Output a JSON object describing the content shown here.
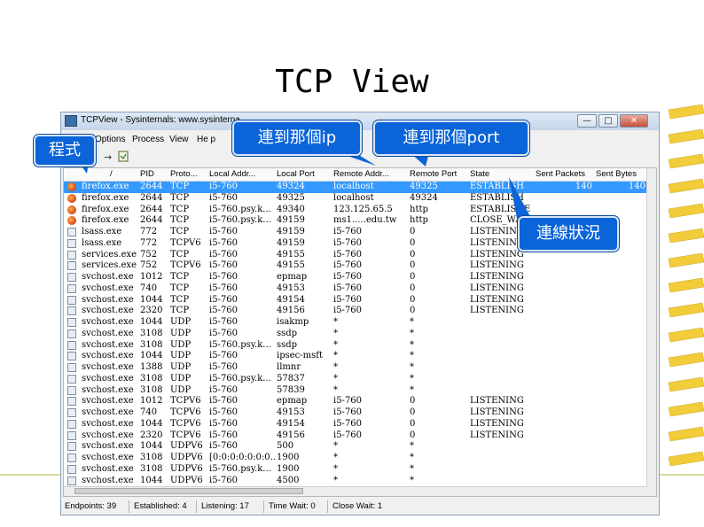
{
  "slide": {
    "title": "TCP View"
  },
  "window": {
    "title": "TCPView - Sysinternals: www.sysinterna",
    "buttons": {
      "minimize": "—",
      "maximize": "□",
      "close": "✕"
    }
  },
  "menu": [
    "Options",
    "Process",
    "View",
    "He p"
  ],
  "toolbar": {
    "refresh_arrow": "→"
  },
  "columns": [
    "",
    "PID",
    "Proto...",
    "Local Addr...",
    "Local Port",
    "Remote Addr...",
    "Remote Port",
    "State",
    "Sent Packets",
    "Sent Bytes"
  ],
  "sort_indicator": "/",
  "rows": [
    {
      "icon": "firefox",
      "process": "firefox.exe",
      "pid": "2644",
      "proto": "TCP",
      "laddr": "i5-760",
      "lport": "49324",
      "raddr": "localhost",
      "rport": "49325",
      "state": "ESTABLISH",
      "packets": "140",
      "bytes": "140",
      "selected": true
    },
    {
      "icon": "firefox",
      "process": "firefox.exe",
      "pid": "2644",
      "proto": "TCP",
      "laddr": "i5-760",
      "lport": "49325",
      "raddr": "localhost",
      "rport": "49324",
      "state": "ESTABLISH",
      "packets": "",
      "bytes": ""
    },
    {
      "icon": "firefox",
      "process": "firefox.exe",
      "pid": "2644",
      "proto": "TCP",
      "laddr": "i5-760.psy.k...",
      "lport": "49340",
      "raddr": "123.125.65.5",
      "rport": "http",
      "state": "ESTABLISHE",
      "packets": "",
      "bytes": ""
    },
    {
      "icon": "firefox",
      "process": "firefox.exe",
      "pid": "2644",
      "proto": "TCP",
      "laddr": "i5-760.psy.k...",
      "lport": "49159",
      "raddr": "ms1.....edu.tw",
      "rport": "http",
      "state": "CLOSE_WA",
      "packets": "",
      "bytes": ""
    },
    {
      "icon": "app",
      "process": "lsass.exe",
      "pid": "772",
      "proto": "TCP",
      "laddr": "i5-760",
      "lport": "49159",
      "raddr": "i5-760",
      "rport": "0",
      "state": "LISTENING",
      "packets": "",
      "bytes": ""
    },
    {
      "icon": "app",
      "process": "lsass.exe",
      "pid": "772",
      "proto": "TCPV6",
      "laddr": "i5-760",
      "lport": "49159",
      "raddr": "i5-760",
      "rport": "0",
      "state": "LISTENING",
      "packets": "",
      "bytes": ""
    },
    {
      "icon": "app",
      "process": "services.exe",
      "pid": "752",
      "proto": "TCP",
      "laddr": "i5-760",
      "lport": "49155",
      "raddr": "i5-760",
      "rport": "0",
      "state": "LISTENING",
      "packets": "",
      "bytes": ""
    },
    {
      "icon": "app",
      "process": "services.exe",
      "pid": "752",
      "proto": "TCPV6",
      "laddr": "i5-760",
      "lport": "49155",
      "raddr": "i5-760",
      "rport": "0",
      "state": "LISTENING",
      "packets": "",
      "bytes": ""
    },
    {
      "icon": "app",
      "process": "svchost.exe",
      "pid": "1012",
      "proto": "TCP",
      "laddr": "i5-760",
      "lport": "epmap",
      "raddr": "i5-760",
      "rport": "0",
      "state": "LISTENING",
      "packets": "",
      "bytes": ""
    },
    {
      "icon": "app",
      "process": "svchost.exe",
      "pid": "740",
      "proto": "TCP",
      "laddr": "i5-760",
      "lport": "49153",
      "raddr": "i5-760",
      "rport": "0",
      "state": "LISTENING",
      "packets": "",
      "bytes": ""
    },
    {
      "icon": "app",
      "process": "svchost.exe",
      "pid": "1044",
      "proto": "TCP",
      "laddr": "i5-760",
      "lport": "49154",
      "raddr": "i5-760",
      "rport": "0",
      "state": "LISTENING",
      "packets": "",
      "bytes": ""
    },
    {
      "icon": "app",
      "process": "svchost.exe",
      "pid": "2320",
      "proto": "TCP",
      "laddr": "i5-760",
      "lport": "49156",
      "raddr": "i5-760",
      "rport": "0",
      "state": "LISTENING",
      "packets": "",
      "bytes": ""
    },
    {
      "icon": "app",
      "process": "svchost.exe",
      "pid": "1044",
      "proto": "UDP",
      "laddr": "i5-760",
      "lport": "isakmp",
      "raddr": "*",
      "rport": "*",
      "state": "",
      "packets": "",
      "bytes": ""
    },
    {
      "icon": "app",
      "process": "svchost.exe",
      "pid": "3108",
      "proto": "UDP",
      "laddr": "i5-760",
      "lport": "ssdp",
      "raddr": "*",
      "rport": "*",
      "state": "",
      "packets": "",
      "bytes": ""
    },
    {
      "icon": "app",
      "process": "svchost.exe",
      "pid": "3108",
      "proto": "UDP",
      "laddr": "i5-760.psy.k...",
      "lport": "ssdp",
      "raddr": "*",
      "rport": "*",
      "state": "",
      "packets": "",
      "bytes": ""
    },
    {
      "icon": "app",
      "process": "svchost.exe",
      "pid": "1044",
      "proto": "UDP",
      "laddr": "i5-760",
      "lport": "ipsec-msft",
      "raddr": "*",
      "rport": "*",
      "state": "",
      "packets": "",
      "bytes": ""
    },
    {
      "icon": "app",
      "process": "svchost.exe",
      "pid": "1388",
      "proto": "UDP",
      "laddr": "i5-760",
      "lport": "llmnr",
      "raddr": "*",
      "rport": "*",
      "state": "",
      "packets": "",
      "bytes": ""
    },
    {
      "icon": "app",
      "process": "svchost.exe",
      "pid": "3108",
      "proto": "UDP",
      "laddr": "i5-760.psy.k...",
      "lport": "57837",
      "raddr": "*",
      "rport": "*",
      "state": "",
      "packets": "",
      "bytes": ""
    },
    {
      "icon": "app",
      "process": "svchost.exe",
      "pid": "3108",
      "proto": "UDP",
      "laddr": "i5-760",
      "lport": "57839",
      "raddr": "*",
      "rport": "*",
      "state": "",
      "packets": "",
      "bytes": ""
    },
    {
      "icon": "app",
      "process": "svchost.exe",
      "pid": "1012",
      "proto": "TCPV6",
      "laddr": "i5-760",
      "lport": "epmap",
      "raddr": "i5-760",
      "rport": "0",
      "state": "LISTENING",
      "packets": "",
      "bytes": ""
    },
    {
      "icon": "app",
      "process": "svchost.exe",
      "pid": "740",
      "proto": "TCPV6",
      "laddr": "i5-760",
      "lport": "49153",
      "raddr": "i5-760",
      "rport": "0",
      "state": "LISTENING",
      "packets": "",
      "bytes": ""
    },
    {
      "icon": "app",
      "process": "svchost.exe",
      "pid": "1044",
      "proto": "TCPV6",
      "laddr": "i5-760",
      "lport": "49154",
      "raddr": "i5-760",
      "rport": "0",
      "state": "LISTENING",
      "packets": "",
      "bytes": ""
    },
    {
      "icon": "app",
      "process": "svchost.exe",
      "pid": "2320",
      "proto": "TCPV6",
      "laddr": "i5-760",
      "lport": "49156",
      "raddr": "i5-760",
      "rport": "0",
      "state": "LISTENING",
      "packets": "",
      "bytes": ""
    },
    {
      "icon": "app",
      "process": "svchost.exe",
      "pid": "1044",
      "proto": "UDPV6",
      "laddr": "i5-760",
      "lport": "500",
      "raddr": "*",
      "rport": "*",
      "state": "",
      "packets": "",
      "bytes": ""
    },
    {
      "icon": "app",
      "process": "svchost.exe",
      "pid": "3108",
      "proto": "UDPV6",
      "laddr": "[0:0:0:0:0:0:0...",
      "lport": "1900",
      "raddr": "*",
      "rport": "*",
      "state": "",
      "packets": "",
      "bytes": ""
    },
    {
      "icon": "app",
      "process": "svchost.exe",
      "pid": "3108",
      "proto": "UDPV6",
      "laddr": "i5-760.psy.k...",
      "lport": "1900",
      "raddr": "*",
      "rport": "*",
      "state": "",
      "packets": "",
      "bytes": ""
    },
    {
      "icon": "app",
      "process": "svchost.exe",
      "pid": "1044",
      "proto": "UDPV6",
      "laddr": "i5-760",
      "lport": "4500",
      "raddr": "*",
      "rport": "*",
      "state": "",
      "packets": "",
      "bytes": ""
    }
  ],
  "status": {
    "endpoints": "Endpoints: 39",
    "established": "Established: 4",
    "listening": "Listening: 17",
    "time_wait": "Time Wait: 0",
    "close_wait": "Close Wait: 1"
  },
  "callouts": {
    "program": "程式",
    "ip": "連到那個ip",
    "port": "連到那個port",
    "status": "連線狀況"
  },
  "colors": {
    "callout": "#0b64d8",
    "selection": "#3399ff",
    "binder": "#f2cc3a"
  }
}
